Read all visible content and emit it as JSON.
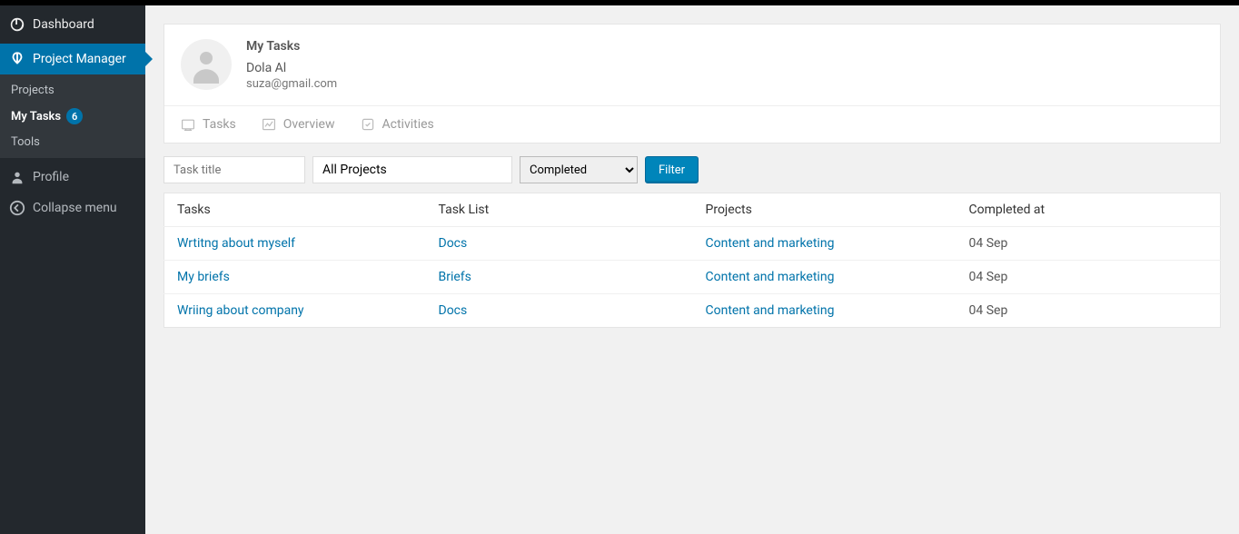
{
  "sidebar": {
    "dashboard": "Dashboard",
    "project_manager": "Project Manager",
    "submenu": {
      "projects": "Projects",
      "my_tasks": "My Tasks",
      "my_tasks_count": "6",
      "tools": "Tools"
    },
    "profile": "Profile",
    "collapse": "Collapse menu"
  },
  "header": {
    "title": "My Tasks",
    "user_name": "Dola Al",
    "user_email": "suza@gmail.com"
  },
  "tabs": {
    "tasks": "Tasks",
    "overview": "Overview",
    "activities": "Activities"
  },
  "filters": {
    "task_title_placeholder": "Task title",
    "project_selected": "All Projects",
    "status_selected": "Completed",
    "button": "Filter"
  },
  "table": {
    "columns": {
      "tasks": "Tasks",
      "task_list": "Task List",
      "projects": "Projects",
      "completed_at": "Completed at"
    },
    "rows": [
      {
        "task": "Wrtitng about myself",
        "list": "Docs",
        "project": "Content and marketing",
        "date": "04 Sep"
      },
      {
        "task": "My briefs",
        "list": "Briefs",
        "project": "Content and marketing",
        "date": "04 Sep"
      },
      {
        "task": "Wriing about company",
        "list": "Docs",
        "project": "Content and marketing",
        "date": "04 Sep"
      }
    ]
  }
}
